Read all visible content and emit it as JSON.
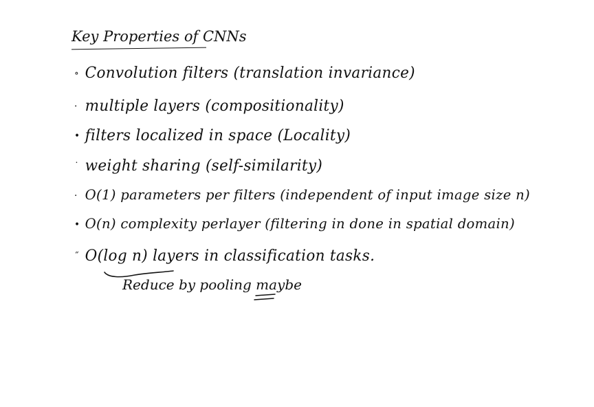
{
  "title": "Key Properties of CNNs",
  "items": [
    {
      "bullet": "∘",
      "text": "Convolution filters  (translation invariance)"
    },
    {
      "bullet": "·",
      "text": "multiple layers  (compositionality)"
    },
    {
      "bullet": "•",
      "text": "filters localized in space  (Locality)"
    },
    {
      "bullet": "˙",
      "text": "weight sharing  (self-similarity)"
    },
    {
      "bullet": "·",
      "text": "O(1) parameters per filters  (independent of input image size n)"
    },
    {
      "bullet": "•",
      "text": "O(n) complexity perlayer  (filtering in done in spatial domain)"
    },
    {
      "bullet": "˝",
      "text": "O(log n)  layers  in classification tasks."
    }
  ],
  "note": "Reduce by pooling maybe"
}
